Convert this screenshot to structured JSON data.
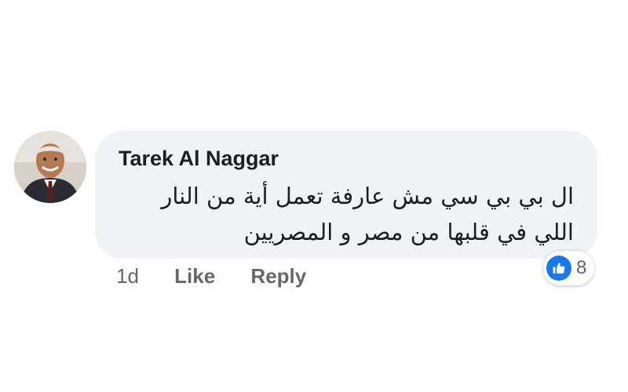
{
  "comment": {
    "author": "Tarek Al Naggar",
    "text_line_1": "ال بي بي سي مش عارفة تعمل أية من النار",
    "text_line_2": "اللي في قلبها من مصر و المصريين",
    "timestamp": "1d",
    "like_label": "Like",
    "reply_label": "Reply",
    "reactions": {
      "icon": "thumbs-up-icon",
      "count": "8",
      "color": "#1877f2"
    }
  },
  "colors": {
    "bubble": "#f0f2f5",
    "text": "#1c1e21",
    "secondary": "#65676b"
  }
}
